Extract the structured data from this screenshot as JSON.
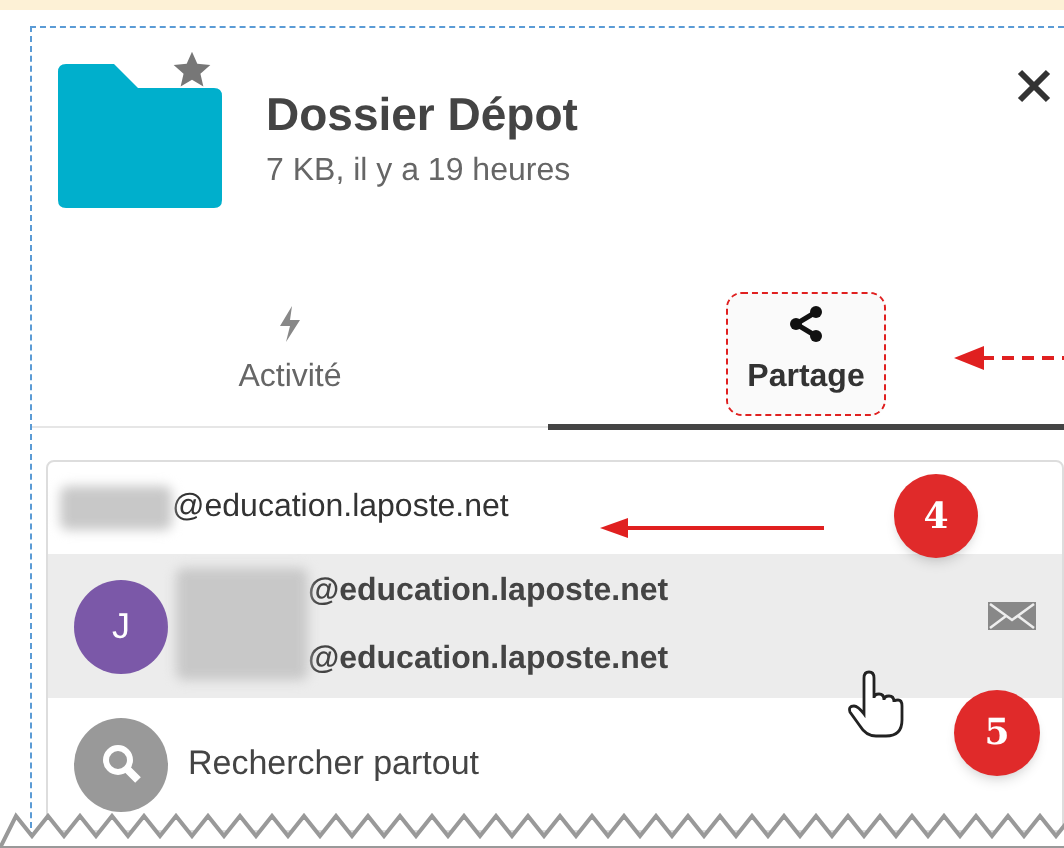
{
  "panel": {
    "title": "Dossier Dépot",
    "subtitle": "7 KB, il y a 19 heures",
    "starred": true
  },
  "tabs": [
    {
      "label": "Activité",
      "kind": "activity",
      "selected": false,
      "highlighted": false
    },
    {
      "label": "Partage",
      "kind": "share",
      "selected": true,
      "highlighted": true
    }
  ],
  "recipient_field": {
    "value": "@education.laposte.net"
  },
  "suggestions": [
    {
      "avatar": "J",
      "lines": [
        "@education.laposte.net",
        "@education.laposte.net"
      ],
      "selected": true
    }
  ],
  "search_everywhere": {
    "label": "Rechercher partout"
  },
  "annotations": {
    "badges": [
      "4",
      "5"
    ]
  }
}
